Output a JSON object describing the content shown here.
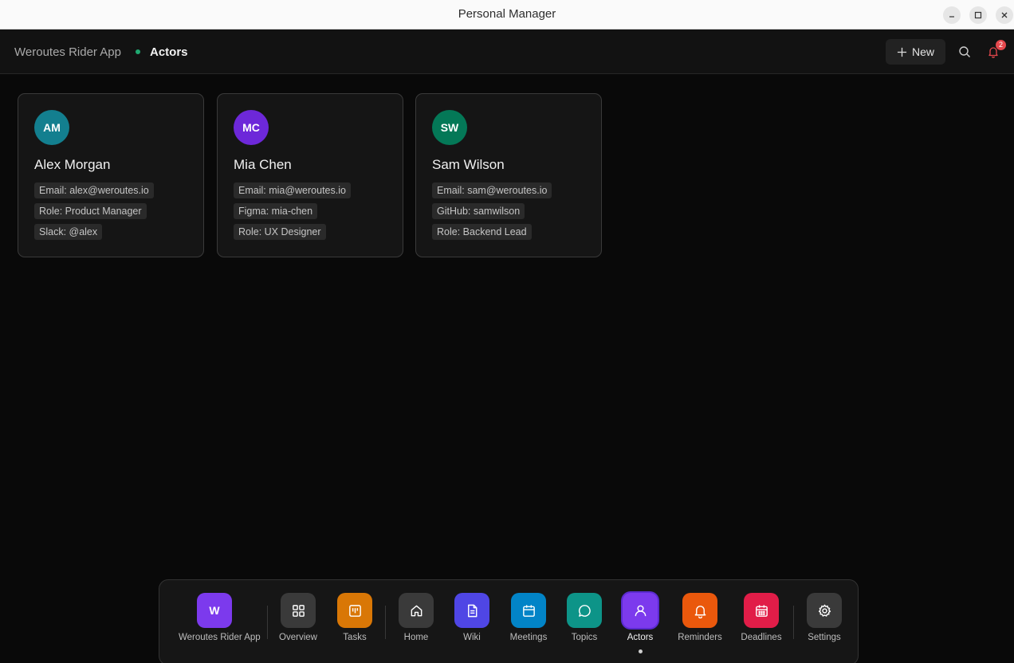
{
  "window": {
    "title": "Personal Manager"
  },
  "header": {
    "project": "Weroutes Rider App",
    "current": "Actors",
    "new_label": "New",
    "notification_count": "2"
  },
  "actors": [
    {
      "initials": "AM",
      "name": "Alex Morgan",
      "color": "#137f8f",
      "tags": [
        "Email: alex@weroutes.io",
        "Role: Product Manager",
        "Slack: @alex"
      ]
    },
    {
      "initials": "MC",
      "name": "Mia Chen",
      "color": "#6d28d9",
      "tags": [
        "Email: mia@weroutes.io",
        "Figma: mia-chen",
        "Role: UX Designer"
      ]
    },
    {
      "initials": "SW",
      "name": "Sam Wilson",
      "color": "#047857",
      "tags": [
        "Email: sam@weroutes.io",
        "GitHub: samwilson",
        "Role: Backend Lead"
      ]
    }
  ],
  "dock": {
    "project_initial": "W",
    "items": [
      {
        "label": "Weroutes Rider App",
        "icon": "project-initial",
        "color": "#7c3aed"
      },
      {
        "label": "Overview",
        "icon": "grid-icon",
        "color": "#3a3a3a"
      },
      {
        "label": "Tasks",
        "icon": "kanban-icon",
        "color": "#d97706"
      },
      {
        "label": "Home",
        "icon": "home-icon",
        "color": "#3a3a3a"
      },
      {
        "label": "Wiki",
        "icon": "document-icon",
        "color": "#4f46e5"
      },
      {
        "label": "Meetings",
        "icon": "calendar-icon",
        "color": "#0284c7"
      },
      {
        "label": "Topics",
        "icon": "chat-bubble-icon",
        "color": "#0d9488"
      },
      {
        "label": "Actors",
        "icon": "user-icon",
        "color": "#7c3aed",
        "active": true
      },
      {
        "label": "Reminders",
        "icon": "bell-icon",
        "color": "#ea580c"
      },
      {
        "label": "Deadlines",
        "icon": "calendar-grid-icon",
        "color": "#e11d48"
      },
      {
        "label": "Settings",
        "icon": "gear-icon",
        "color": "#3a3a3a"
      }
    ]
  }
}
